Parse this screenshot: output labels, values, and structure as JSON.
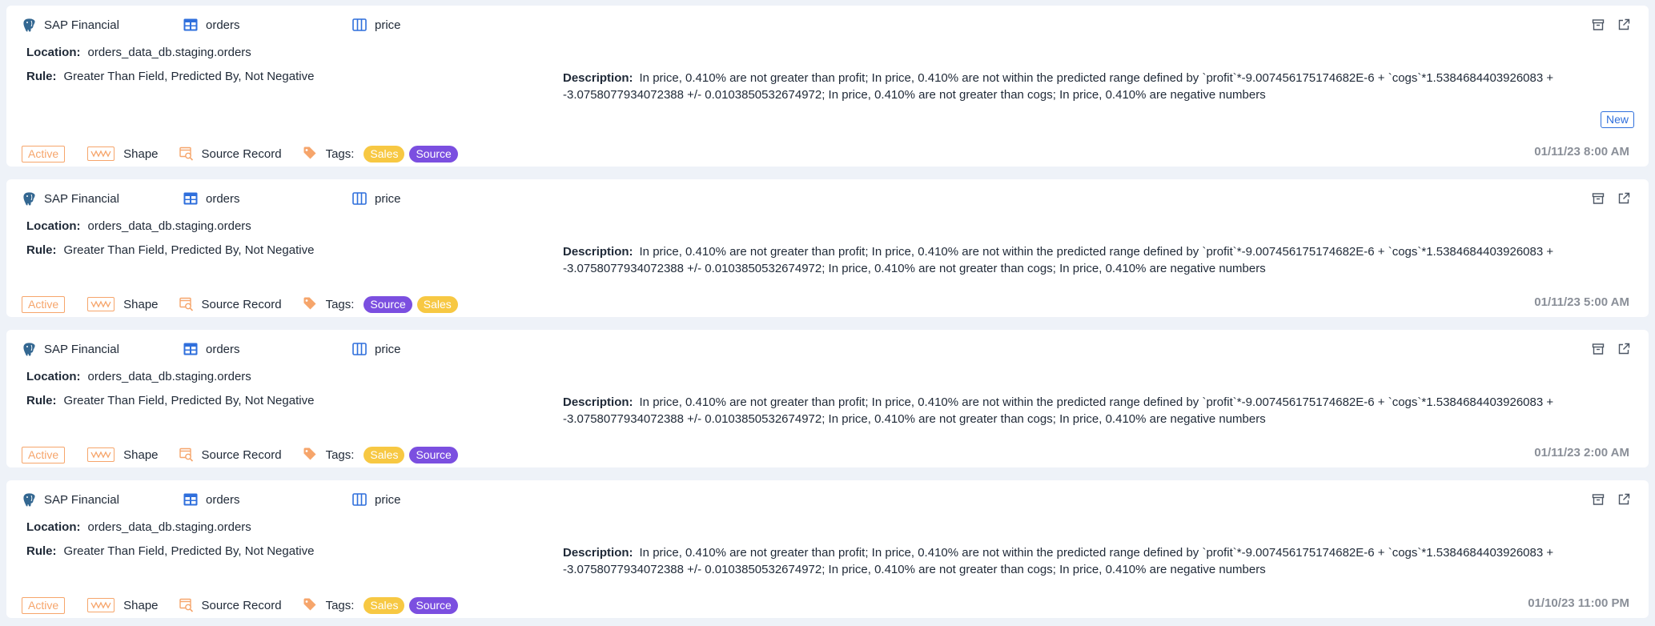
{
  "labels": {
    "location": "Location:",
    "rule": "Rule:",
    "description": "Description:",
    "tags": "Tags:",
    "shape": "Shape",
    "source_record": "Source Record"
  },
  "icons": {
    "datasource": "postgres-elephant-icon",
    "table": "table-icon",
    "field": "column-icon",
    "archive": "archive-icon",
    "open": "external-link-icon",
    "shape": "shape-wave-icon",
    "source_record": "source-record-search-icon",
    "tag": "tag-icon"
  },
  "colors": {
    "accent_blue": "#2f6fdc",
    "status_orange": "#f6a56b",
    "tag_sales": "#f7c843",
    "tag_source": "#7b4fe0"
  },
  "anomalies": [
    {
      "datasource": "SAP Financial",
      "table": "orders",
      "field": "price",
      "location": "orders_data_db.staging.orders",
      "rule": "Greater Than Field, Predicted By, Not Negative",
      "description": "In price, 0.410% are not greater than profit; In price, 0.410% are not within the predicted range defined by `profit`*-9.007456175174682E-6 + `cogs`*1.5384684403926083 + -3.0758077934072388 +/- 0.0103850532674972; In price, 0.410% are not greater than cogs; In price, 0.410% are negative numbers",
      "new_badge": "New",
      "status": "Active",
      "tags": [
        "Sales",
        "Source"
      ],
      "timestamp": "01/11/23 8:00 AM"
    },
    {
      "datasource": "SAP Financial",
      "table": "orders",
      "field": "price",
      "location": "orders_data_db.staging.orders",
      "rule": "Greater Than Field, Predicted By, Not Negative",
      "description": "In price, 0.410% are not greater than profit; In price, 0.410% are not within the predicted range defined by `profit`*-9.007456175174682E-6 + `cogs`*1.5384684403926083 + -3.0758077934072388 +/- 0.0103850532674972; In price, 0.410% are not greater than cogs; In price, 0.410% are negative numbers",
      "status": "Active",
      "tags": [
        "Source",
        "Sales"
      ],
      "timestamp": "01/11/23 5:00 AM"
    },
    {
      "datasource": "SAP Financial",
      "table": "orders",
      "field": "price",
      "location": "orders_data_db.staging.orders",
      "rule": "Greater Than Field, Predicted By, Not Negative",
      "description": "In price, 0.410% are not greater than profit; In price, 0.410% are not within the predicted range defined by `profit`*-9.007456175174682E-6 + `cogs`*1.5384684403926083 + -3.0758077934072388 +/- 0.0103850532674972; In price, 0.410% are not greater than cogs; In price, 0.410% are negative numbers",
      "status": "Active",
      "tags": [
        "Sales",
        "Source"
      ],
      "timestamp": "01/11/23 2:00 AM"
    },
    {
      "datasource": "SAP Financial",
      "table": "orders",
      "field": "price",
      "location": "orders_data_db.staging.orders",
      "rule": "Greater Than Field, Predicted By, Not Negative",
      "description": "In price, 0.410% are not greater than profit; In price, 0.410% are not within the predicted range defined by `profit`*-9.007456175174682E-6 + `cogs`*1.5384684403926083 + -3.0758077934072388 +/- 0.0103850532674972; In price, 0.410% are not greater than cogs; In price, 0.410% are negative numbers",
      "status": "Active",
      "tags": [
        "Sales",
        "Source"
      ],
      "timestamp": "01/10/23 11:00 PM"
    }
  ]
}
